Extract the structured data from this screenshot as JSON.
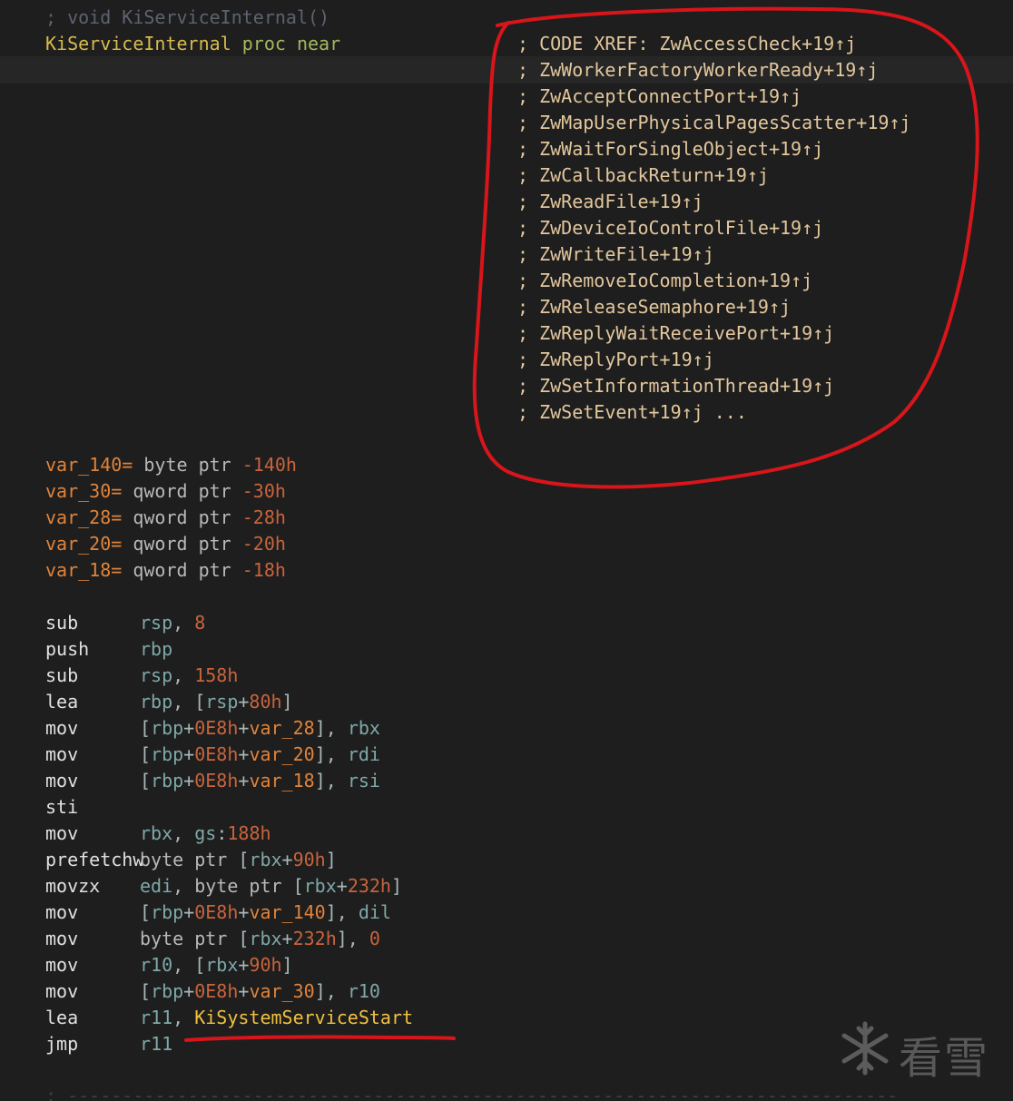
{
  "header": {
    "comment": "; void KiServiceInternal()",
    "proc_name": "KiServiceInternal",
    "proc_kw": "proc",
    "near_kw": "near"
  },
  "xrefs": [
    "; CODE XREF: ZwAccessCheck+19↑j",
    "; ZwWorkerFactoryWorkerReady+19↑j",
    "; ZwAcceptConnectPort+19↑j",
    "; ZwMapUserPhysicalPagesScatter+19↑j",
    "; ZwWaitForSingleObject+19↑j",
    "; ZwCallbackReturn+19↑j",
    "; ZwReadFile+19↑j",
    "; ZwDeviceIoControlFile+19↑j",
    "; ZwWriteFile+19↑j",
    "; ZwRemoveIoCompletion+19↑j",
    "; ZwReleaseSemaphore+19↑j",
    "; ZwReplyWaitReceivePort+19↑j",
    "; ZwReplyPort+19↑j",
    "; ZwSetInformationThread+19↑j",
    "; ZwSetEvent+19↑j ..."
  ],
  "vars": [
    {
      "name": "var_140=",
      "type": " byte ptr ",
      "off": "-140h"
    },
    {
      "name": "var_30=",
      "type": " qword ptr ",
      "off": "-30h"
    },
    {
      "name": "var_28=",
      "type": " qword ptr ",
      "off": "-28h"
    },
    {
      "name": "var_20=",
      "type": " qword ptr ",
      "off": "-20h"
    },
    {
      "name": "var_18=",
      "type": " qword ptr ",
      "off": "-18h"
    }
  ],
  "code": [
    {
      "m": "sub",
      "ops": [
        [
          "reg",
          "rsp"
        ],
        [
          "punct",
          ", "
        ],
        [
          "num",
          "8"
        ]
      ]
    },
    {
      "m": "push",
      "ops": [
        [
          "reg",
          "rbp"
        ]
      ]
    },
    {
      "m": "sub",
      "ops": [
        [
          "reg",
          "rsp"
        ],
        [
          "punct",
          ", "
        ],
        [
          "num",
          "158h"
        ]
      ]
    },
    {
      "m": "lea",
      "ops": [
        [
          "reg",
          "rbp"
        ],
        [
          "punct",
          ", ["
        ],
        [
          "reg",
          "rsp"
        ],
        [
          "punct",
          "+"
        ],
        [
          "num",
          "80h"
        ],
        [
          "punct",
          "]"
        ]
      ]
    },
    {
      "m": "mov",
      "ops": [
        [
          "punct",
          "["
        ],
        [
          "reg",
          "rbp"
        ],
        [
          "punct",
          "+"
        ],
        [
          "num",
          "0E8h"
        ],
        [
          "punct",
          "+"
        ],
        [
          "var",
          "var_28"
        ],
        [
          "punct",
          "], "
        ],
        [
          "reg",
          "rbx"
        ]
      ]
    },
    {
      "m": "mov",
      "ops": [
        [
          "punct",
          "["
        ],
        [
          "reg",
          "rbp"
        ],
        [
          "punct",
          "+"
        ],
        [
          "num",
          "0E8h"
        ],
        [
          "punct",
          "+"
        ],
        [
          "var",
          "var_20"
        ],
        [
          "punct",
          "], "
        ],
        [
          "reg",
          "rdi"
        ]
      ]
    },
    {
      "m": "mov",
      "ops": [
        [
          "punct",
          "["
        ],
        [
          "reg",
          "rbp"
        ],
        [
          "punct",
          "+"
        ],
        [
          "num",
          "0E8h"
        ],
        [
          "punct",
          "+"
        ],
        [
          "var",
          "var_18"
        ],
        [
          "punct",
          "], "
        ],
        [
          "reg",
          "rsi"
        ]
      ]
    },
    {
      "m": "sti",
      "ops": []
    },
    {
      "m": "mov",
      "ops": [
        [
          "reg",
          "rbx"
        ],
        [
          "punct",
          ", "
        ],
        [
          "reg",
          "gs"
        ],
        [
          "punct",
          ":"
        ],
        [
          "num",
          "188h"
        ]
      ]
    },
    {
      "m": "prefetchw",
      "ops": [
        [
          "type",
          "byte ptr "
        ],
        [
          "punct",
          "["
        ],
        [
          "reg",
          "rbx"
        ],
        [
          "punct",
          "+"
        ],
        [
          "num",
          "90h"
        ],
        [
          "punct",
          "]"
        ]
      ]
    },
    {
      "m": "movzx",
      "ops": [
        [
          "reg",
          "edi"
        ],
        [
          "punct",
          ", "
        ],
        [
          "type",
          "byte ptr "
        ],
        [
          "punct",
          "["
        ],
        [
          "reg",
          "rbx"
        ],
        [
          "punct",
          "+"
        ],
        [
          "num",
          "232h"
        ],
        [
          "punct",
          "]"
        ]
      ]
    },
    {
      "m": "mov",
      "ops": [
        [
          "punct",
          "["
        ],
        [
          "reg",
          "rbp"
        ],
        [
          "punct",
          "+"
        ],
        [
          "num",
          "0E8h"
        ],
        [
          "punct",
          "+"
        ],
        [
          "var",
          "var_140"
        ],
        [
          "punct",
          "], "
        ],
        [
          "reg",
          "dil"
        ]
      ]
    },
    {
      "m": "mov",
      "ops": [
        [
          "type",
          "byte ptr "
        ],
        [
          "punct",
          "["
        ],
        [
          "reg",
          "rbx"
        ],
        [
          "punct",
          "+"
        ],
        [
          "num",
          "232h"
        ],
        [
          "punct",
          "], "
        ],
        [
          "num",
          "0"
        ]
      ]
    },
    {
      "m": "mov",
      "ops": [
        [
          "reg",
          "r10"
        ],
        [
          "punct",
          ", ["
        ],
        [
          "reg",
          "rbx"
        ],
        [
          "punct",
          "+"
        ],
        [
          "num",
          "90h"
        ],
        [
          "punct",
          "]"
        ]
      ]
    },
    {
      "m": "mov",
      "ops": [
        [
          "punct",
          "["
        ],
        [
          "reg",
          "rbp"
        ],
        [
          "punct",
          "+"
        ],
        [
          "num",
          "0E8h"
        ],
        [
          "punct",
          "+"
        ],
        [
          "var",
          "var_30"
        ],
        [
          "punct",
          "], "
        ],
        [
          "reg",
          "r10"
        ]
      ]
    },
    {
      "m": "lea",
      "ops": [
        [
          "reg",
          "r11"
        ],
        [
          "punct",
          ", "
        ],
        [
          "sym",
          "KiSystemServiceStart"
        ]
      ]
    },
    {
      "m": "jmp",
      "ops": [
        [
          "reg",
          "r11"
        ]
      ]
    }
  ],
  "separator": "; ----------------------------------------------------------------------------",
  "watermark": {
    "text": "看雪",
    "icon": "snowflake-icon"
  },
  "colors": {
    "annotation": "#d8151a",
    "background": "#1e1e1e"
  }
}
